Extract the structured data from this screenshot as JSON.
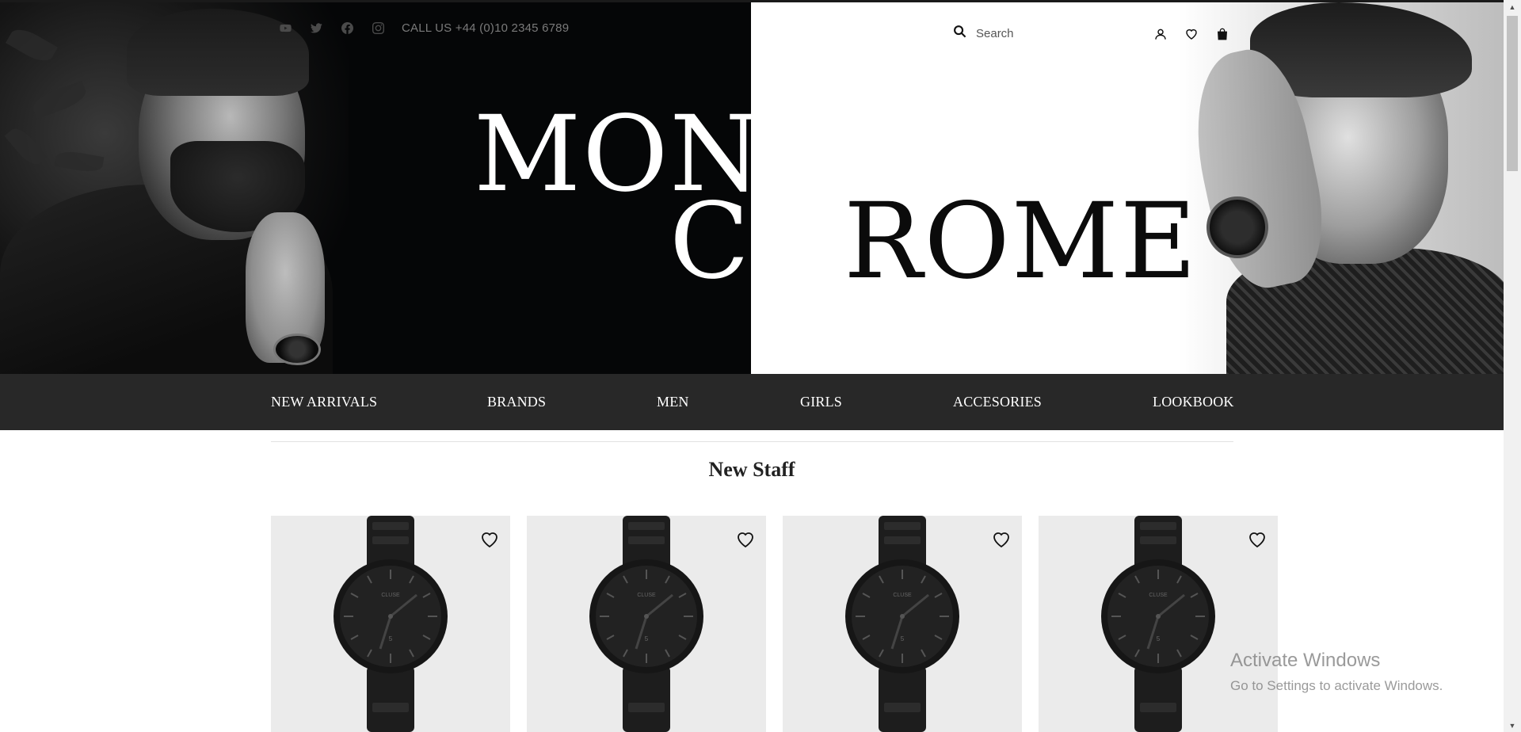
{
  "topbar": {
    "social": [
      "youtube-icon",
      "twitter-icon",
      "facebook-icon",
      "instagram-icon"
    ],
    "call_text": "CALL US +44 (0)10 2345 6789",
    "search_placeholder": "Search",
    "icons": [
      "user-icon",
      "heart-icon",
      "bag-icon"
    ]
  },
  "hero": {
    "logo_line1": "MONO",
    "logo_line2_white": "CH",
    "logo_line2_black": "ROME"
  },
  "nav": {
    "items": [
      {
        "label": "NEW ARRIVALS"
      },
      {
        "label": "BRANDS"
      },
      {
        "label": "MEN"
      },
      {
        "label": "GIRLS"
      },
      {
        "label": "ACCESORIES"
      },
      {
        "label": "LOOKBOOK"
      }
    ]
  },
  "section": {
    "title": "New Staff"
  },
  "products": [
    {
      "brand": "CLUSE",
      "date": "5"
    },
    {
      "brand": "CLUSE",
      "date": "5"
    },
    {
      "brand": "CLUSE",
      "date": "5"
    },
    {
      "brand": "CLUSE",
      "date": "5"
    }
  ],
  "watermark": {
    "title": "Activate Windows",
    "subtitle": "Go to Settings to activate Windows."
  },
  "colors": {
    "nav_bg": "#282828",
    "hero_dark": "#050607",
    "card_bg": "#ebebeb"
  }
}
